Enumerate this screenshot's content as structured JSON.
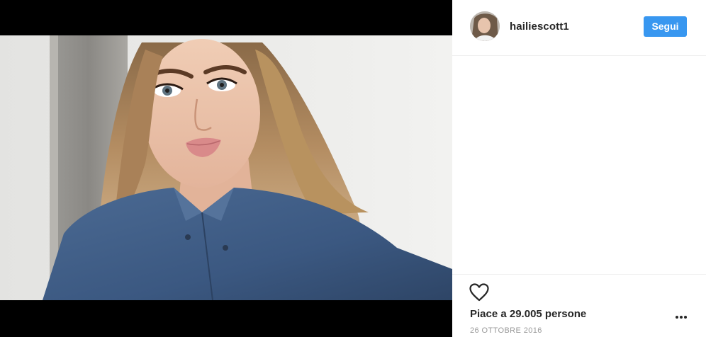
{
  "post": {
    "username": "hailiescott1",
    "follow_label": "Segui",
    "likes_text": "Piace a 29.005 persone",
    "date_text": "26 OTTOBRE 2016"
  },
  "icons": {
    "like": "heart-outline-icon",
    "more": "more-options-icon"
  },
  "colors": {
    "accent": "#3897f0",
    "text": "#262626",
    "muted": "#999999",
    "divider": "#efefef"
  }
}
